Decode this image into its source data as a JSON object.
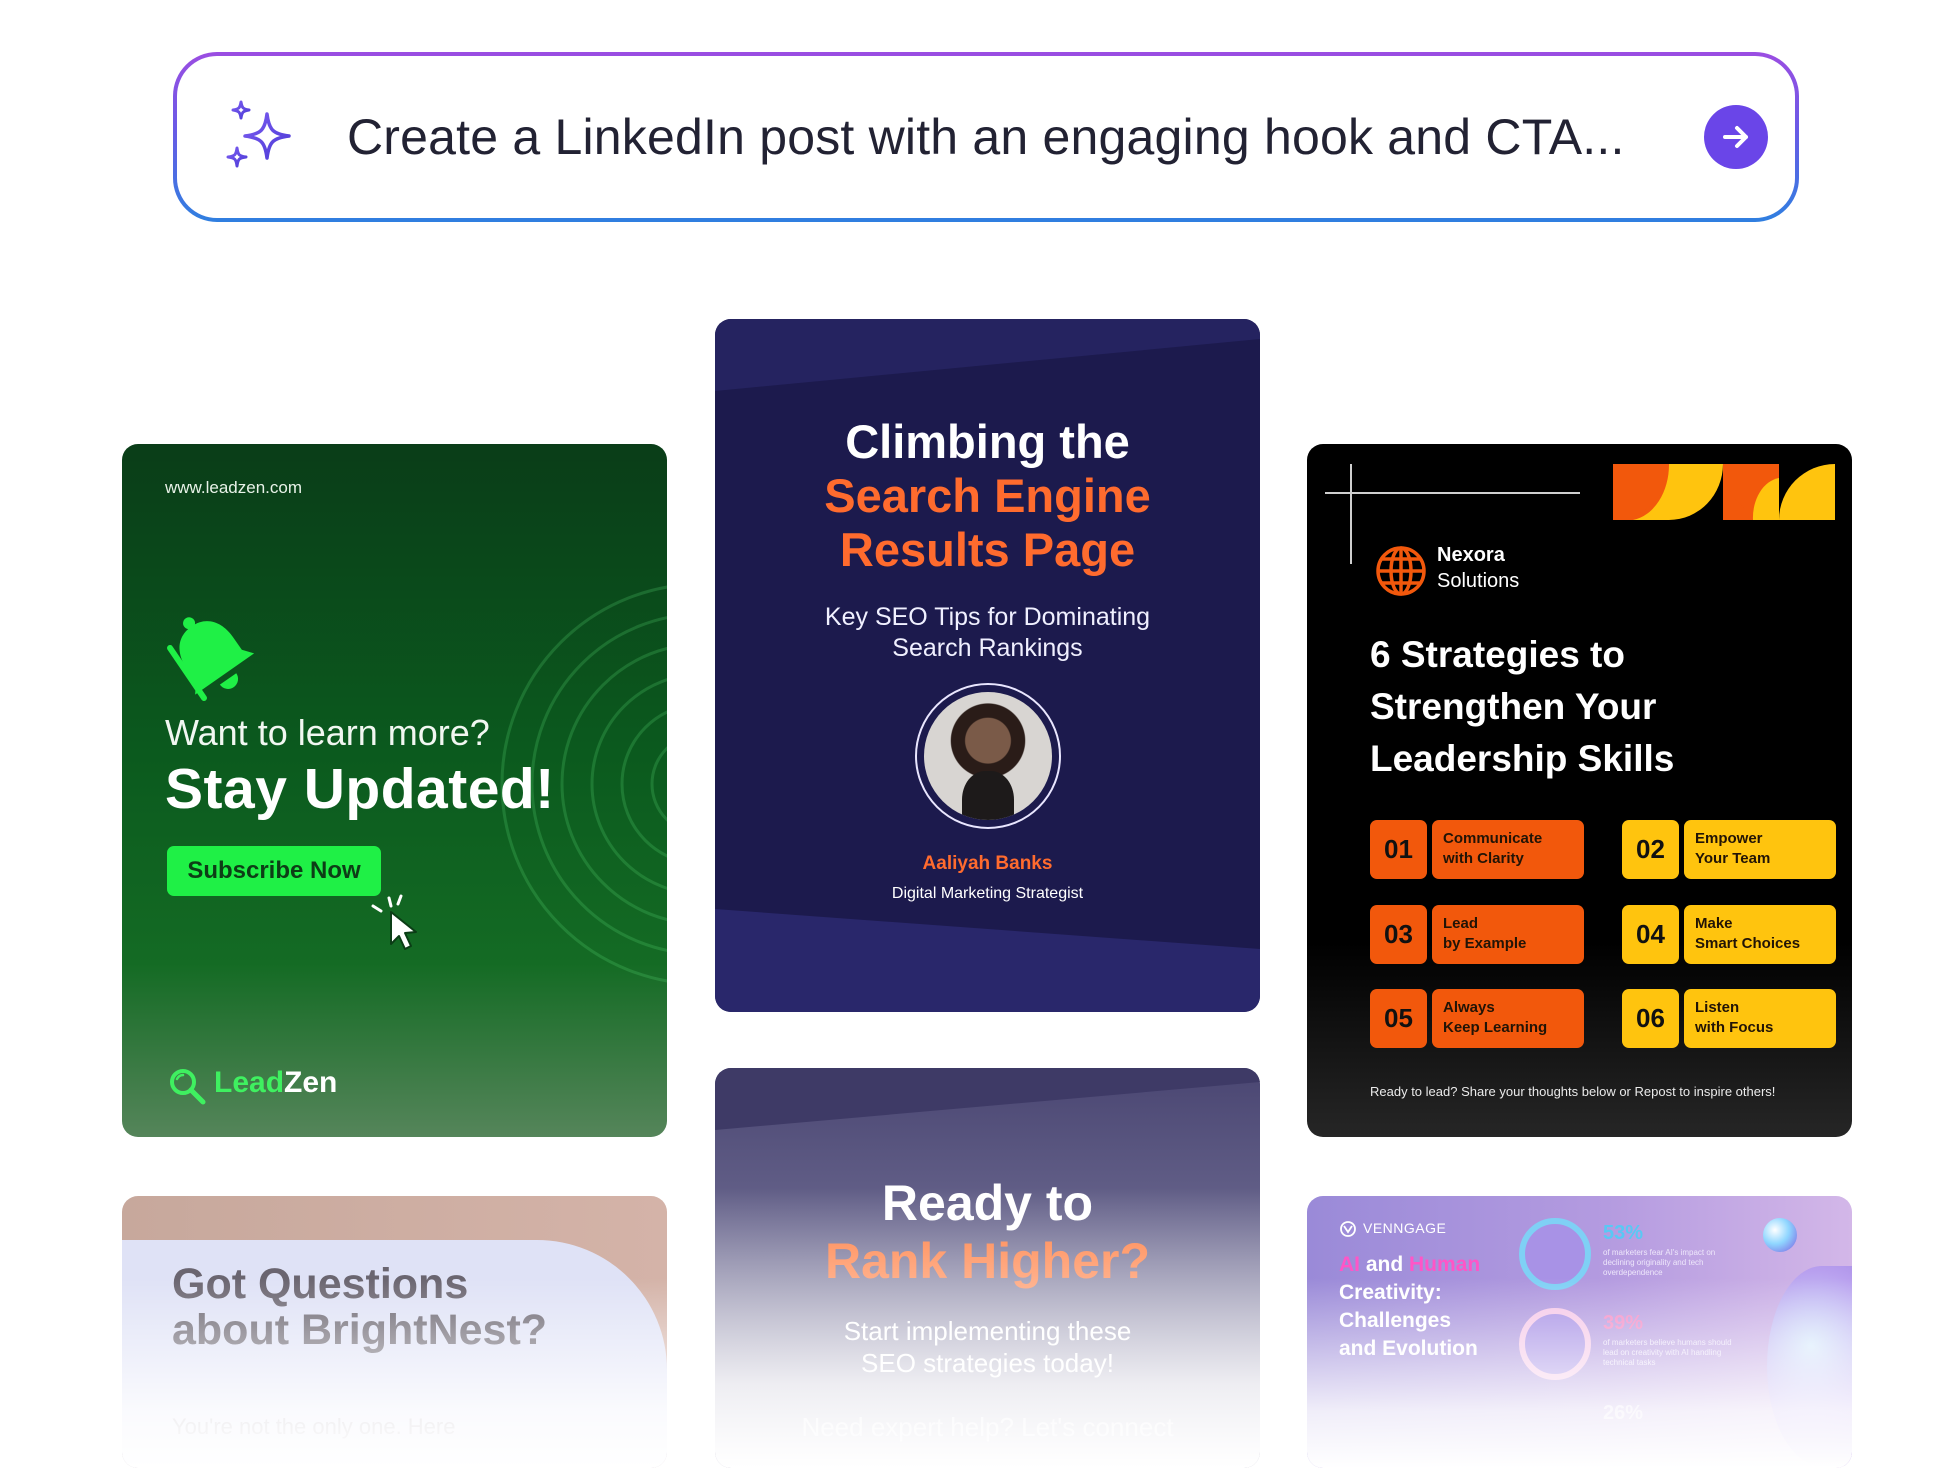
{
  "prompt": {
    "text": "Create a LinkedIn post with an engaging hook and CTA...",
    "icon": "sparkles-icon",
    "send_icon": "arrow-right-icon",
    "accent": "#6a45e8"
  },
  "cards": {
    "leadzen": {
      "url": "www.leadzen.com",
      "question": "Want to learn more?",
      "headline": "Stay Updated!",
      "button": "Subscribe Now",
      "logo_part1": "Lead",
      "logo_part2": "Zen",
      "bg_color": "#0b5a1e",
      "accent": "#1ff046"
    },
    "seo": {
      "title_line1": "Climbing the",
      "title_line2": "Search Engine",
      "title_line3": "Results Page",
      "subtitle_line1": "Key SEO Tips for Dominating",
      "subtitle_line2": "Search Rankings",
      "name": "Aaliyah Banks",
      "role": "Digital Marketing Strategist",
      "bg_color": "#1c1a4d",
      "accent": "#ff6b2e"
    },
    "nexora": {
      "brand_line1": "Nexora",
      "brand_line2": "Solutions",
      "title_line1": "6 Strategies to",
      "title_line2": "Strengthen Your",
      "title_line3": "Leadership Skills",
      "items": [
        {
          "num": "01",
          "line1": "Communicate",
          "line2": "with Clarity",
          "color": "orange"
        },
        {
          "num": "02",
          "line1": "Empower",
          "line2": "Your Team",
          "color": "yellow"
        },
        {
          "num": "03",
          "line1": "Lead",
          "line2": "by Example",
          "color": "orange"
        },
        {
          "num": "04",
          "line1": "Make",
          "line2": "Smart Choices",
          "color": "yellow"
        },
        {
          "num": "05",
          "line1": "Always",
          "line2": "Keep Learning",
          "color": "orange"
        },
        {
          "num": "06",
          "line1": "Listen",
          "line2": "with Focus",
          "color": "yellow"
        }
      ],
      "footer": "Ready to lead? Share your thoughts below or Repost to inspire others!",
      "orange": "#f2580c",
      "yellow": "#ffc40e"
    },
    "brightnest": {
      "title_line1": "Got Questions",
      "title_line2": "about BrightNest?",
      "subtitle": "You're not the only one. Here"
    },
    "rank": {
      "title_line1": "Ready to",
      "title_line2": "Rank Higher?",
      "sub_line1": "Start implementing these",
      "sub_line2": "SEO strategies today!",
      "sub_line3": "Need expert help? Let's connect"
    },
    "ai": {
      "brand": "VENNGAGE",
      "title_ai": "AI",
      "title_and": " and ",
      "title_human": "Human",
      "title_creativity": "Creativity:",
      "title_line3": "Challenges",
      "title_line4": "and Evolution",
      "stat1": "53%",
      "stat1_desc": "of marketers fear AI's impact on declining originality and tech overdependence",
      "stat2": "39%",
      "stat2_desc": "of marketers believe humans should lead on creativity with AI handling technical tasks",
      "stat3": "26%"
    }
  }
}
